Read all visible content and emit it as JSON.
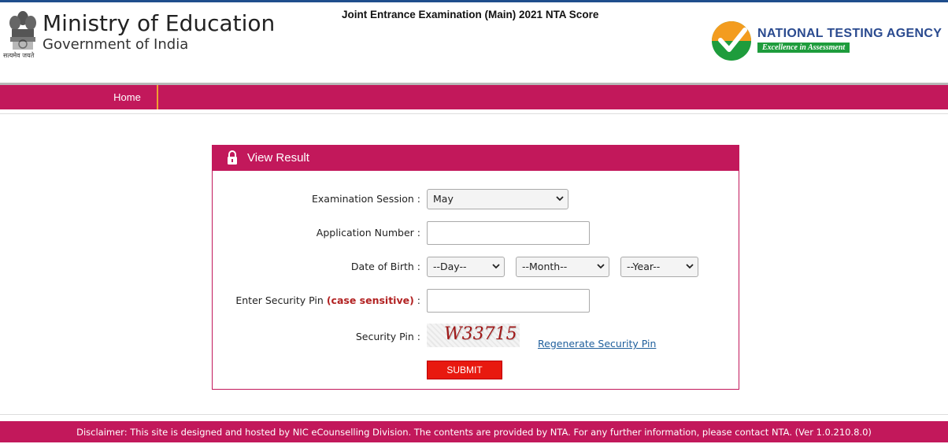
{
  "header": {
    "emblem_caption": "सत्यमेव जयते",
    "ministry_title": "Ministry of Education",
    "ministry_subtitle": "Government of India",
    "exam_title": "Joint Entrance Examination (Main) 2021 NTA Score",
    "agency_name": "NATIONAL TESTING AGENCY",
    "agency_tagline": "Excellence in Assessment"
  },
  "nav": {
    "items": [
      {
        "label": "Home"
      }
    ]
  },
  "panel": {
    "title": "View Result",
    "fields": {
      "session_label": "Examination Session :",
      "session_value": "May",
      "appno_label": "Application Number :",
      "appno_value": "",
      "dob_label": "Date of Birth :",
      "dob_day": "--Day--",
      "dob_month": "--Month--",
      "dob_year": "--Year--",
      "pin_label_prefix": "Enter Security Pin",
      "pin_label_emphasis": "(case sensitive)",
      "pin_label_suffix": ":",
      "pin_value": "",
      "captcha_label": "Security Pin :",
      "captcha_text": "W33715",
      "regenerate_link": "Regenerate Security Pin",
      "submit_label": "SUBMIT"
    }
  },
  "footer": {
    "disclaimer": "Disclaimer: This site is designed and hosted by NIC eCounselling Division. The contents are provided by NTA. For any further information, please contact NTA. (Ver 1.0.210.8.0)"
  },
  "colors": {
    "brand": "#c2185b",
    "submit": "#e8190f",
    "link": "#1f5f9c",
    "agency_green": "#1e9c3c",
    "agency_blue": "#2a4a8f"
  },
  "icons": [
    "national-emblem-icon",
    "nta-logo-icon",
    "lock-icon",
    "chevron-down-icon"
  ]
}
